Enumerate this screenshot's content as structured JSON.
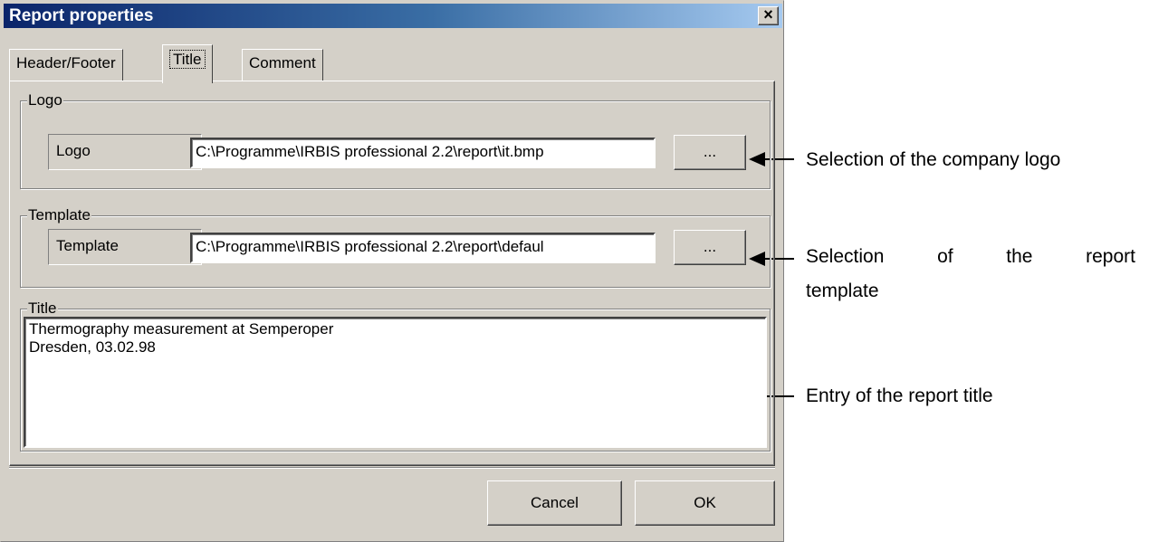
{
  "window": {
    "title": "Report properties",
    "close_glyph": "×"
  },
  "tabs": [
    {
      "label": "Header/Footer"
    },
    {
      "label": "Title"
    },
    {
      "label": "Comment"
    }
  ],
  "logo_group": {
    "legend": "Logo",
    "label": "Logo",
    "value": "C:\\Programme\\IRBIS professional 2.2\\report\\it.bmp",
    "browse_label": "..."
  },
  "template_group": {
    "legend": "Template",
    "label": "Template",
    "value": "C:\\Programme\\IRBIS professional 2.2\\report\\defaul",
    "browse_label": "..."
  },
  "title_group": {
    "legend": "Title",
    "line1": "Thermography measurement at Semperoper",
    "line2": "Dresden, 03.02.98"
  },
  "footer": {
    "cancel_label": "Cancel",
    "ok_label": "OK"
  },
  "annotations": {
    "logo": "Selection of the company logo",
    "template_line1": "Selection of the report",
    "template_line2": "template",
    "title": "Entry of the report title"
  }
}
